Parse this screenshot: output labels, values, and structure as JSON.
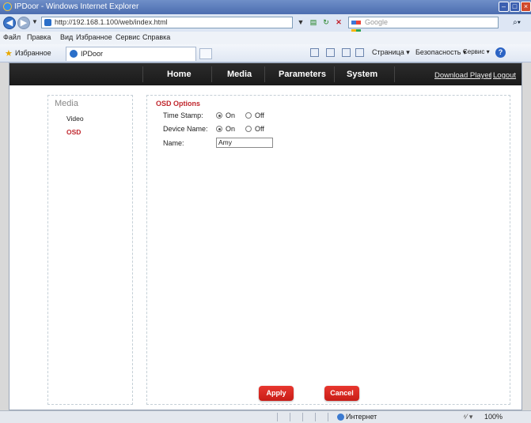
{
  "window": {
    "title": "IPDoor - Windows Internet Explorer",
    "minimize": "–",
    "maximize": "□",
    "close": "×"
  },
  "address": {
    "url": "http://192.168.1.100/web/index.html",
    "search_placeholder": "Google",
    "search_button": "⌕▾"
  },
  "menu": [
    "Файл",
    "Правка",
    "Вид",
    "Избранное",
    "Сервис",
    "Справка"
  ],
  "favorites": {
    "label": "Избранное",
    "tab_title": "IPDoor",
    "commands": [
      "Страница ▾",
      "Безопасность ▾",
      "Сервис ▾"
    ],
    "help": "?"
  },
  "nav": {
    "items": [
      "Home",
      "Media",
      "Parameters",
      "System"
    ],
    "download": "Download Player",
    "separator": "|",
    "logout": "Logout"
  },
  "sidebar": {
    "heading": "Media",
    "items": [
      "Video",
      "OSD"
    ],
    "active_color": "#c0272d"
  },
  "osd": {
    "title": "OSD Options",
    "rows": [
      {
        "label": "Time Stamp:",
        "on": "On",
        "off": "Off",
        "selected": "On"
      },
      {
        "label": "Device Name:",
        "on": "On",
        "off": "Off",
        "selected": "On"
      }
    ],
    "name_label": "Name:",
    "name_value": "Amy"
  },
  "buttons": {
    "apply": "Apply",
    "cancel": "Cancel"
  },
  "status": {
    "zone": "Интернет",
    "zoom": "100%",
    "protected": "⁴⁄ ▾"
  }
}
